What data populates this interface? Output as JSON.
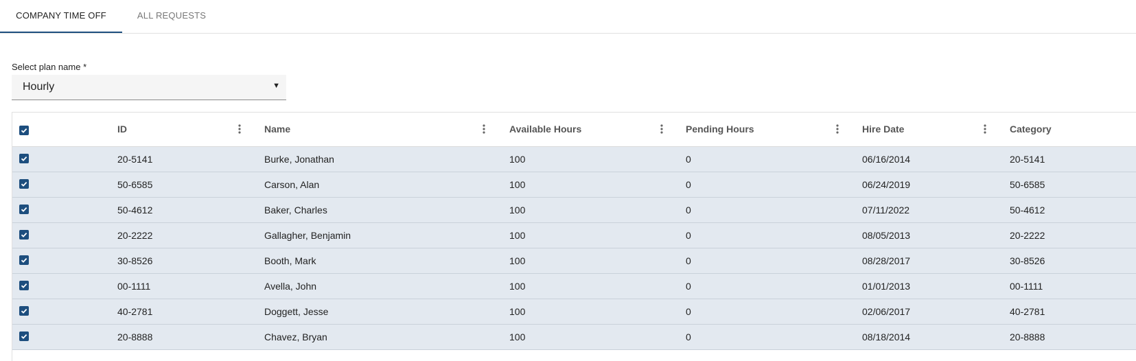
{
  "tabs": [
    {
      "label": "COMPANY TIME OFF"
    },
    {
      "label": "ALL REQUESTS"
    }
  ],
  "plan_select": {
    "label": "Select plan name *",
    "value": "Hourly"
  },
  "table": {
    "columns": [
      "ID",
      "Name",
      "Available Hours",
      "Pending Hours",
      "Hire Date",
      "Category"
    ],
    "rows": [
      {
        "id": "20-5141",
        "name": "Burke, Jonathan",
        "available": "100",
        "pending": "0",
        "hire_date": "06/16/2014",
        "category": "20-5141"
      },
      {
        "id": "50-6585",
        "name": "Carson, Alan",
        "available": "100",
        "pending": "0",
        "hire_date": "06/24/2019",
        "category": "50-6585"
      },
      {
        "id": "50-4612",
        "name": "Baker, Charles",
        "available": "100",
        "pending": "0",
        "hire_date": "07/11/2022",
        "category": "50-4612"
      },
      {
        "id": "20-2222",
        "name": "Gallagher, Benjamin",
        "available": "100",
        "pending": "0",
        "hire_date": "08/05/2013",
        "category": "20-2222"
      },
      {
        "id": "30-8526",
        "name": "Booth, Mark",
        "available": "100",
        "pending": "0",
        "hire_date": "08/28/2017",
        "category": "30-8526"
      },
      {
        "id": "00-1111",
        "name": "Avella, John",
        "available": "100",
        "pending": "0",
        "hire_date": "01/01/2013",
        "category": "00-1111"
      },
      {
        "id": "40-2781",
        "name": "Doggett, Jesse",
        "available": "100",
        "pending": "0",
        "hire_date": "02/06/2017",
        "category": "40-2781"
      },
      {
        "id": "20-8888",
        "name": "Chavez, Bryan",
        "available": "100",
        "pending": "0",
        "hire_date": "08/18/2014",
        "category": "20-8888"
      }
    ]
  },
  "colors": {
    "accent": "#1d4e7e",
    "selected_row": "#e3e9f0"
  }
}
